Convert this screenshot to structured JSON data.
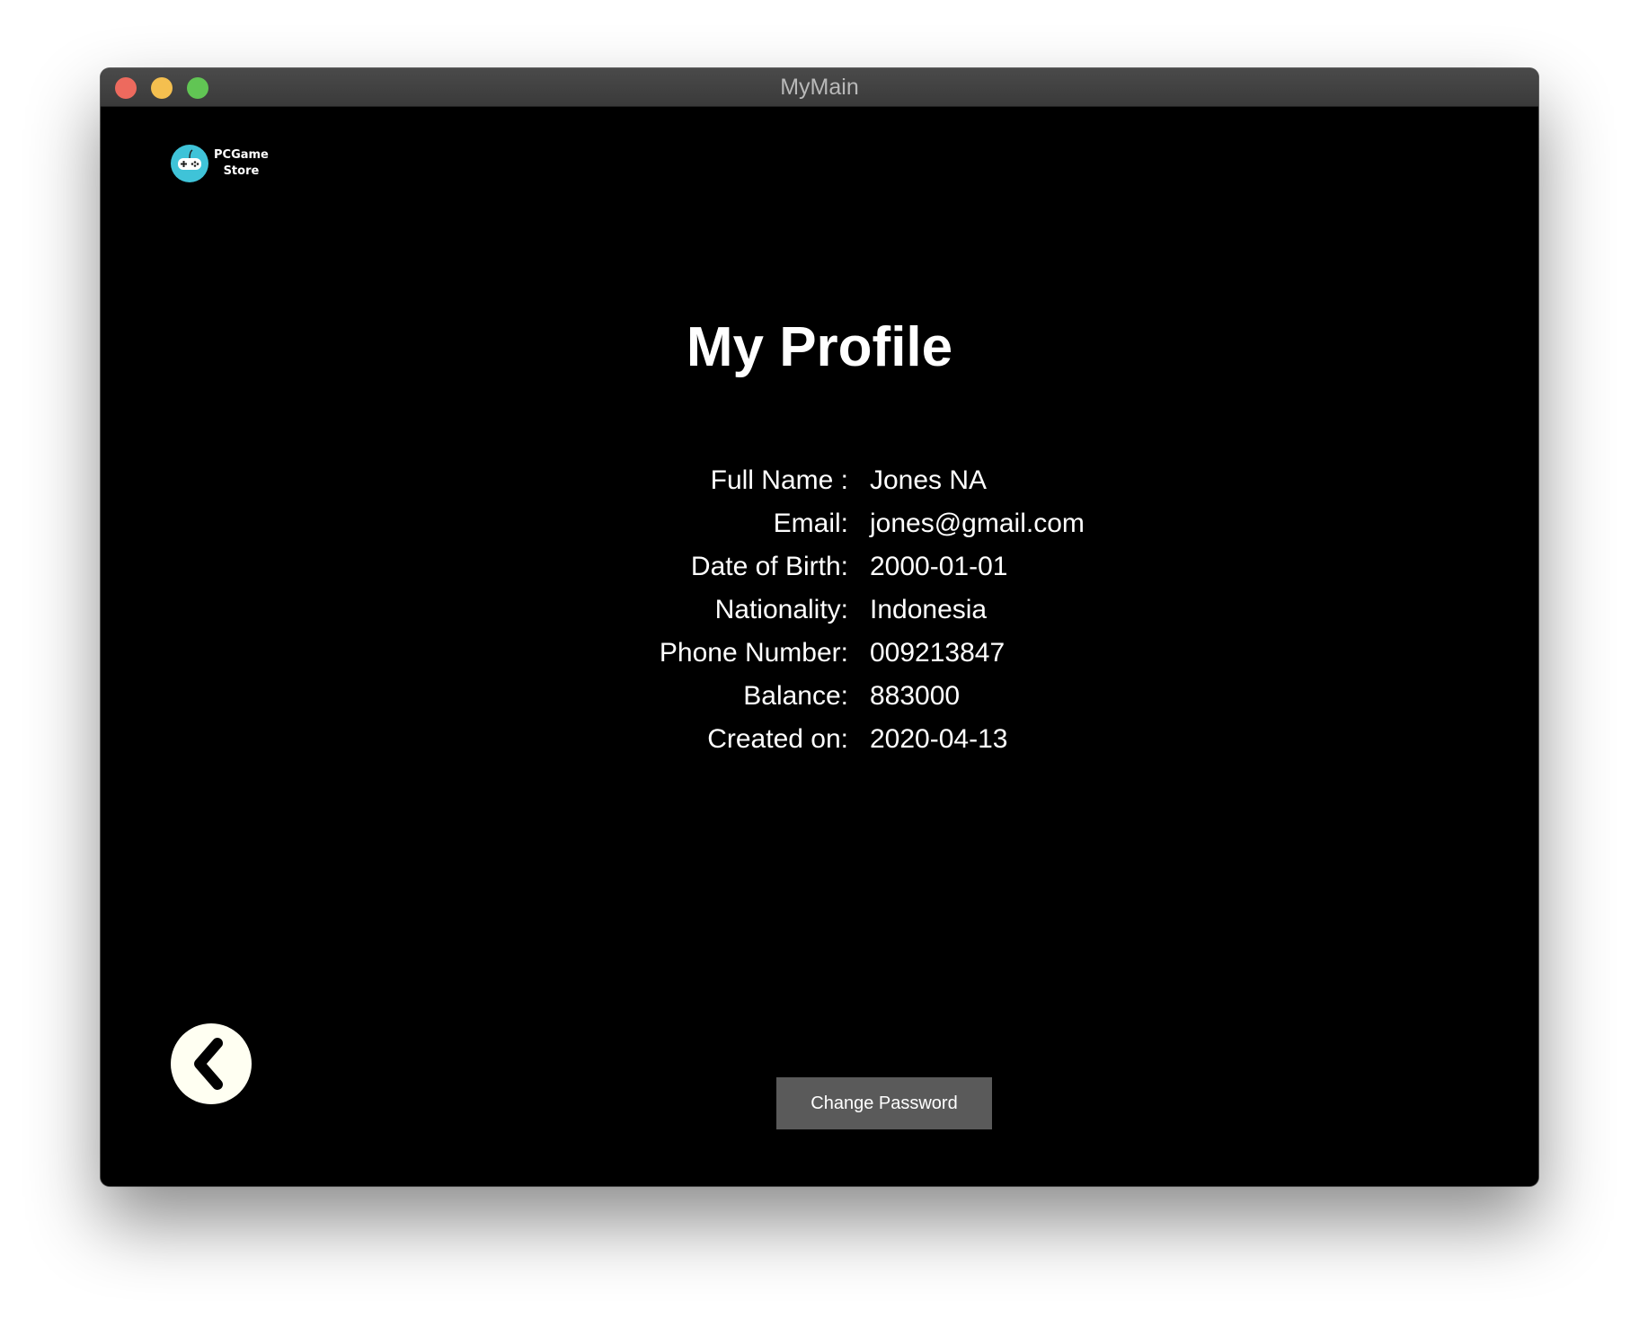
{
  "window": {
    "title": "MyMain"
  },
  "logo": {
    "line1": "PCGame",
    "line2": "Store"
  },
  "page": {
    "title": "My Profile"
  },
  "profile": [
    {
      "label": "Full Name :",
      "value": "Jones NA"
    },
    {
      "label": "Email:",
      "value": "jones@gmail.com"
    },
    {
      "label": "Date of Birth:",
      "value": "2000-01-01"
    },
    {
      "label": "Nationality:",
      "value": "Indonesia"
    },
    {
      "label": "Phone Number:",
      "value": "009213847"
    },
    {
      "label": "Balance:",
      "value": "883000"
    },
    {
      "label": "Created on:",
      "value": "2020-04-13"
    }
  ],
  "buttons": {
    "change_password": "Change Password"
  },
  "colors": {
    "background": "#000000",
    "logo_circle": "#3fc3d8",
    "button_bg": "#5a5a5a",
    "back_button_bg": "#fffff2"
  },
  "icons": {
    "back": "chevron-left-icon",
    "logo": "gamepad-icon"
  }
}
